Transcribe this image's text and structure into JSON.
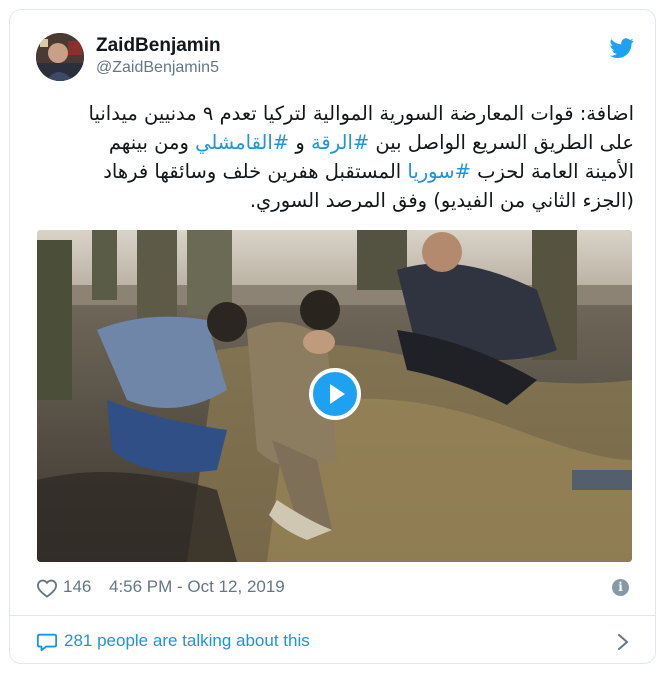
{
  "author": {
    "display_name": "ZaidBenjamin",
    "handle": "@ZaidBenjamin5"
  },
  "tweet": {
    "line1": "اضافة: قوات المعارضة السورية الموالية لتركيا تعدم ٩ مدنيين ميدانيا",
    "line2_before": "على الطريق السريع الواصل بين ",
    "hashtag_raqqa": "#الرقة",
    "line2_mid": " و ",
    "hashtag_qamishli": "#القامشلي",
    "line2_after": " ومن بينهم",
    "line3_before": "الأمينة العامة لحزب ",
    "hashtag_syria": "#سوريا",
    "line3_after": " المستقبل هفرين خلف وسائقها فرهاد",
    "line4": "(الجزء الثاني من الفيديو) وفق المرصد السوري."
  },
  "meta": {
    "like_count": "146",
    "timestamp": "4:56 PM - Oct 12, 2019",
    "info_glyph": "i"
  },
  "footer": {
    "talking_text": "281 people are talking about this"
  },
  "icons": {
    "brand": "twitter-bird-icon",
    "like": "heart-icon",
    "info": "info-icon",
    "reply": "speech-bubble-icon",
    "chevron": "chevron-right-icon",
    "play": "play-icon"
  },
  "colors": {
    "accent": "#1da1f2",
    "link": "#1b95e0",
    "muted": "#657786",
    "text": "#14171a",
    "border": "#e1e8ed"
  }
}
